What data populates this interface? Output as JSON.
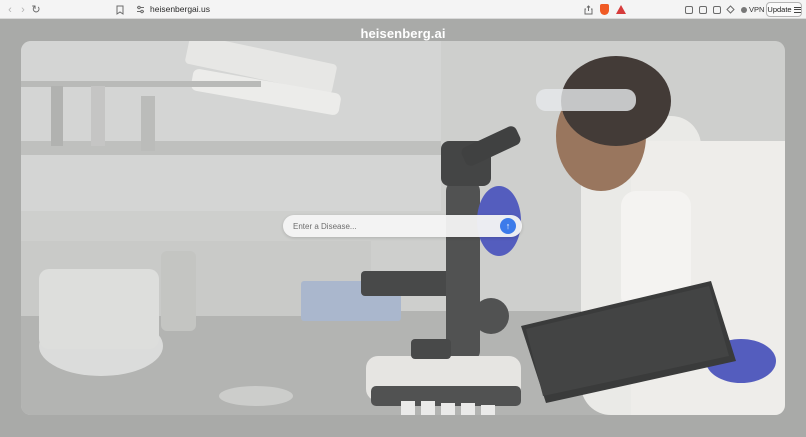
{
  "browser": {
    "url": "heisenbergai.us",
    "vpn_label": "VPN",
    "update_label": "Update",
    "icons": {
      "back": "chevron-left-icon",
      "forward": "chevron-right-icon",
      "reload": "reload-icon",
      "bookmark": "bookmark-icon",
      "site_settings": "site-settings-icon",
      "share": "share-icon",
      "brave_shields": "brave-shield-icon",
      "brave_rewards": "bat-rewards-icon",
      "menu": "hamburger-menu-icon"
    },
    "colors": {
      "brave": "#f05a24",
      "bat": "#d63b3b"
    }
  },
  "page": {
    "brand": "heisenberg.ai",
    "search": {
      "placeholder": "Enter a Disease...",
      "value": ""
    },
    "colors": {
      "accent": "#3d7bea",
      "background": "#a9aaa8"
    }
  }
}
